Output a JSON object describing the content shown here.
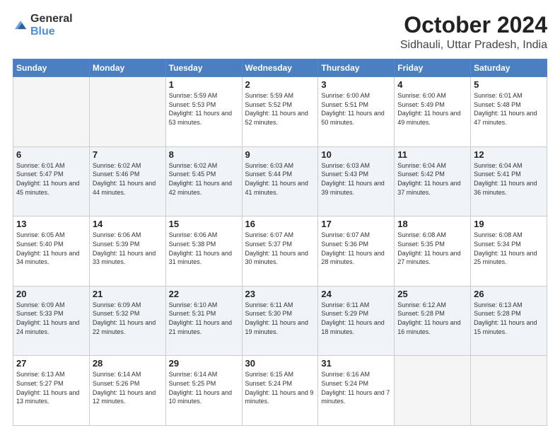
{
  "header": {
    "logo_general": "General",
    "logo_blue": "Blue",
    "title": "October 2024",
    "subtitle": "Sidhauli, Uttar Pradesh, India"
  },
  "days_of_week": [
    "Sunday",
    "Monday",
    "Tuesday",
    "Wednesday",
    "Thursday",
    "Friday",
    "Saturday"
  ],
  "weeks": [
    [
      {
        "day": "",
        "empty": true
      },
      {
        "day": "",
        "empty": true
      },
      {
        "day": "1",
        "sunrise": "Sunrise: 5:59 AM",
        "sunset": "Sunset: 5:53 PM",
        "daylight": "Daylight: 11 hours and 53 minutes."
      },
      {
        "day": "2",
        "sunrise": "Sunrise: 5:59 AM",
        "sunset": "Sunset: 5:52 PM",
        "daylight": "Daylight: 11 hours and 52 minutes."
      },
      {
        "day": "3",
        "sunrise": "Sunrise: 6:00 AM",
        "sunset": "Sunset: 5:51 PM",
        "daylight": "Daylight: 11 hours and 50 minutes."
      },
      {
        "day": "4",
        "sunrise": "Sunrise: 6:00 AM",
        "sunset": "Sunset: 5:49 PM",
        "daylight": "Daylight: 11 hours and 49 minutes."
      },
      {
        "day": "5",
        "sunrise": "Sunrise: 6:01 AM",
        "sunset": "Sunset: 5:48 PM",
        "daylight": "Daylight: 11 hours and 47 minutes."
      }
    ],
    [
      {
        "day": "6",
        "sunrise": "Sunrise: 6:01 AM",
        "sunset": "Sunset: 5:47 PM",
        "daylight": "Daylight: 11 hours and 45 minutes."
      },
      {
        "day": "7",
        "sunrise": "Sunrise: 6:02 AM",
        "sunset": "Sunset: 5:46 PM",
        "daylight": "Daylight: 11 hours and 44 minutes."
      },
      {
        "day": "8",
        "sunrise": "Sunrise: 6:02 AM",
        "sunset": "Sunset: 5:45 PM",
        "daylight": "Daylight: 11 hours and 42 minutes."
      },
      {
        "day": "9",
        "sunrise": "Sunrise: 6:03 AM",
        "sunset": "Sunset: 5:44 PM",
        "daylight": "Daylight: 11 hours and 41 minutes."
      },
      {
        "day": "10",
        "sunrise": "Sunrise: 6:03 AM",
        "sunset": "Sunset: 5:43 PM",
        "daylight": "Daylight: 11 hours and 39 minutes."
      },
      {
        "day": "11",
        "sunrise": "Sunrise: 6:04 AM",
        "sunset": "Sunset: 5:42 PM",
        "daylight": "Daylight: 11 hours and 37 minutes."
      },
      {
        "day": "12",
        "sunrise": "Sunrise: 6:04 AM",
        "sunset": "Sunset: 5:41 PM",
        "daylight": "Daylight: 11 hours and 36 minutes."
      }
    ],
    [
      {
        "day": "13",
        "sunrise": "Sunrise: 6:05 AM",
        "sunset": "Sunset: 5:40 PM",
        "daylight": "Daylight: 11 hours and 34 minutes."
      },
      {
        "day": "14",
        "sunrise": "Sunrise: 6:06 AM",
        "sunset": "Sunset: 5:39 PM",
        "daylight": "Daylight: 11 hours and 33 minutes."
      },
      {
        "day": "15",
        "sunrise": "Sunrise: 6:06 AM",
        "sunset": "Sunset: 5:38 PM",
        "daylight": "Daylight: 11 hours and 31 minutes."
      },
      {
        "day": "16",
        "sunrise": "Sunrise: 6:07 AM",
        "sunset": "Sunset: 5:37 PM",
        "daylight": "Daylight: 11 hours and 30 minutes."
      },
      {
        "day": "17",
        "sunrise": "Sunrise: 6:07 AM",
        "sunset": "Sunset: 5:36 PM",
        "daylight": "Daylight: 11 hours and 28 minutes."
      },
      {
        "day": "18",
        "sunrise": "Sunrise: 6:08 AM",
        "sunset": "Sunset: 5:35 PM",
        "daylight": "Daylight: 11 hours and 27 minutes."
      },
      {
        "day": "19",
        "sunrise": "Sunrise: 6:08 AM",
        "sunset": "Sunset: 5:34 PM",
        "daylight": "Daylight: 11 hours and 25 minutes."
      }
    ],
    [
      {
        "day": "20",
        "sunrise": "Sunrise: 6:09 AM",
        "sunset": "Sunset: 5:33 PM",
        "daylight": "Daylight: 11 hours and 24 minutes."
      },
      {
        "day": "21",
        "sunrise": "Sunrise: 6:09 AM",
        "sunset": "Sunset: 5:32 PM",
        "daylight": "Daylight: 11 hours and 22 minutes."
      },
      {
        "day": "22",
        "sunrise": "Sunrise: 6:10 AM",
        "sunset": "Sunset: 5:31 PM",
        "daylight": "Daylight: 11 hours and 21 minutes."
      },
      {
        "day": "23",
        "sunrise": "Sunrise: 6:11 AM",
        "sunset": "Sunset: 5:30 PM",
        "daylight": "Daylight: 11 hours and 19 minutes."
      },
      {
        "day": "24",
        "sunrise": "Sunrise: 6:11 AM",
        "sunset": "Sunset: 5:29 PM",
        "daylight": "Daylight: 11 hours and 18 minutes."
      },
      {
        "day": "25",
        "sunrise": "Sunrise: 6:12 AM",
        "sunset": "Sunset: 5:28 PM",
        "daylight": "Daylight: 11 hours and 16 minutes."
      },
      {
        "day": "26",
        "sunrise": "Sunrise: 6:13 AM",
        "sunset": "Sunset: 5:28 PM",
        "daylight": "Daylight: 11 hours and 15 minutes."
      }
    ],
    [
      {
        "day": "27",
        "sunrise": "Sunrise: 6:13 AM",
        "sunset": "Sunset: 5:27 PM",
        "daylight": "Daylight: 11 hours and 13 minutes."
      },
      {
        "day": "28",
        "sunrise": "Sunrise: 6:14 AM",
        "sunset": "Sunset: 5:26 PM",
        "daylight": "Daylight: 11 hours and 12 minutes."
      },
      {
        "day": "29",
        "sunrise": "Sunrise: 6:14 AM",
        "sunset": "Sunset: 5:25 PM",
        "daylight": "Daylight: 11 hours and 10 minutes."
      },
      {
        "day": "30",
        "sunrise": "Sunrise: 6:15 AM",
        "sunset": "Sunset: 5:24 PM",
        "daylight": "Daylight: 11 hours and 9 minutes."
      },
      {
        "day": "31",
        "sunrise": "Sunrise: 6:16 AM",
        "sunset": "Sunset: 5:24 PM",
        "daylight": "Daylight: 11 hours and 7 minutes."
      },
      {
        "day": "",
        "empty": true
      },
      {
        "day": "",
        "empty": true
      }
    ]
  ]
}
